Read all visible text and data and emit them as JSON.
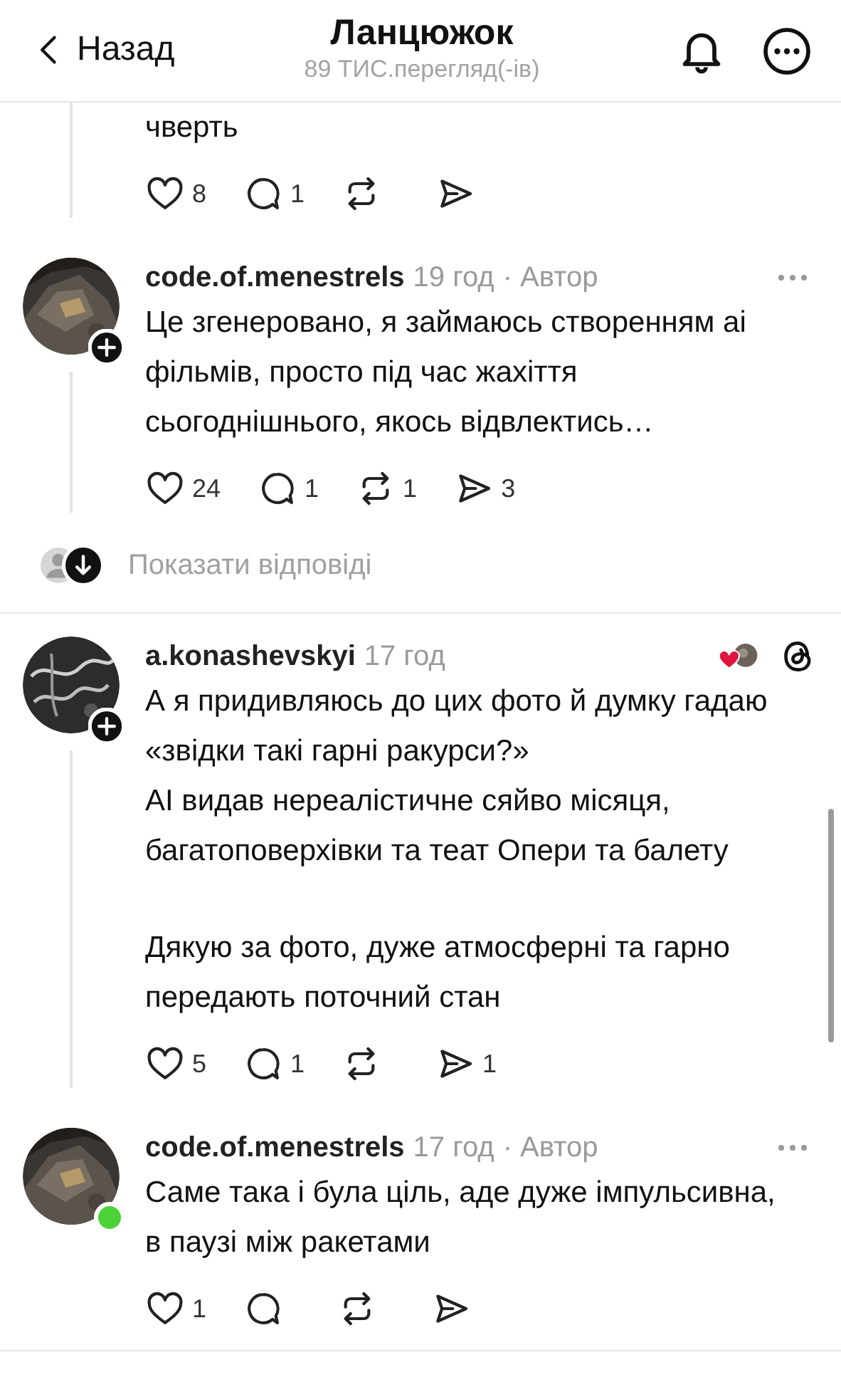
{
  "header": {
    "back": "Назад",
    "title": "Ланцюжок",
    "subtitle": "89 ТИС.перегляд(-ів)"
  },
  "items": [
    {
      "kind": "post_tail",
      "thread_line": true,
      "paragraph_groups": [
        [
          "чверть"
        ]
      ],
      "actions": [
        {
          "kind": "like",
          "count": "8"
        },
        {
          "kind": "reply",
          "count": "1"
        },
        {
          "kind": "repost"
        },
        {
          "kind": "share"
        }
      ]
    },
    {
      "kind": "post",
      "thread_line": true,
      "follow_button": true,
      "online": false,
      "more_menu": true,
      "liked_by_author": false,
      "author": "code.of.menestrels",
      "time": "19 год",
      "tag": "· Автор",
      "paragraph_groups": [
        [
          "Це згенеровано, я займаюсь створенням аі фільмів, просто під час жахіття сьогоднішнього, якось відвлектись…"
        ]
      ],
      "actions": [
        {
          "kind": "like",
          "count": "24"
        },
        {
          "kind": "reply",
          "count": "1"
        },
        {
          "kind": "repost",
          "count": "1"
        },
        {
          "kind": "share",
          "count": "3"
        }
      ]
    },
    {
      "kind": "show_replies",
      "label": "Показати відповіді"
    },
    {
      "kind": "divider"
    },
    {
      "kind": "post",
      "thread_line": true,
      "follow_button": true,
      "online": false,
      "more_menu": false,
      "liked_by_author": true,
      "author": "a.konashevskyi",
      "time": "17 год",
      "paragraph_groups": [
        [
          "А я придивляюсь до цих фото й думку гадаю «звідки такі гарні ракурси?»",
          "AI видав нереалістичне сяйво місяця, багатоповерхівки та теат Опери та балету"
        ],
        [
          "Дякую за фото, дуже атмосферні та гарно передають поточний стан"
        ]
      ],
      "actions": [
        {
          "kind": "like",
          "count": "5"
        },
        {
          "kind": "reply",
          "count": "1"
        },
        {
          "kind": "repost"
        },
        {
          "kind": "share",
          "count": "1"
        }
      ]
    },
    {
      "kind": "post",
      "thread_line": false,
      "follow_button": false,
      "online": true,
      "more_menu": true,
      "liked_by_author": false,
      "author": "code.of.menestrels",
      "time": "17 год",
      "tag": "· Автор",
      "paragraph_groups": [
        [
          "Саме така і була ціль, аде дуже імпульсивна, в паузі між ракетами"
        ]
      ],
      "actions": [
        {
          "kind": "like",
          "count": "1"
        },
        {
          "kind": "reply"
        },
        {
          "kind": "repost"
        },
        {
          "kind": "share"
        }
      ]
    },
    {
      "kind": "divider"
    }
  ]
}
